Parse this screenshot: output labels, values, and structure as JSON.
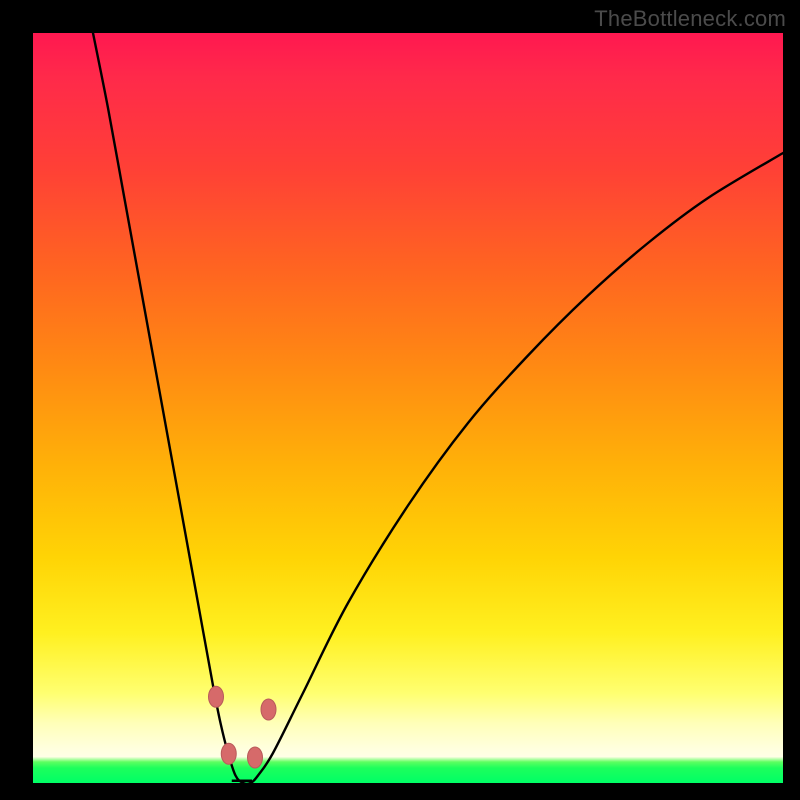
{
  "watermark": "TheBottleneck.com",
  "colors": {
    "frame": "#000000",
    "curve": "#000000",
    "dot_fill": "#d66a6a",
    "dot_stroke": "#b85a5a",
    "gradient_top": "#ff1850",
    "gradient_bottom_green": "#00ff66"
  },
  "chart_data": {
    "type": "line",
    "title": "",
    "xlabel": "",
    "ylabel": "",
    "xlim": [
      0,
      100
    ],
    "ylim": [
      0,
      100
    ],
    "grid": false,
    "legend": false,
    "series": [
      {
        "name": "bottleneck-curve",
        "x": [
          8,
          10,
          12,
          14,
          16,
          18,
          20,
          22,
          24,
          25,
          26,
          27,
          28,
          29,
          30,
          32,
          36,
          42,
          50,
          58,
          66,
          74,
          82,
          90,
          100
        ],
        "y": [
          100,
          90,
          79,
          68,
          57,
          46,
          35,
          24,
          13,
          8,
          4,
          1,
          0,
          0,
          1,
          4,
          12,
          24,
          37,
          48,
          57,
          65,
          72,
          78,
          84
        ],
        "note": "y is approximate bottleneck percentage; minimum (optimum) near x≈28"
      }
    ],
    "markers": [
      {
        "name": "left-upper-dot",
        "x": 24.4,
        "y": 11.5
      },
      {
        "name": "left-lower-dot",
        "x": 26.1,
        "y": 3.9
      },
      {
        "name": "right-lower-dot",
        "x": 29.6,
        "y": 3.4
      },
      {
        "name": "right-upper-dot",
        "x": 31.4,
        "y": 9.8
      }
    ],
    "flat_bottom": {
      "x_start": 26.5,
      "x_end": 29.2,
      "y": 0.3
    }
  }
}
